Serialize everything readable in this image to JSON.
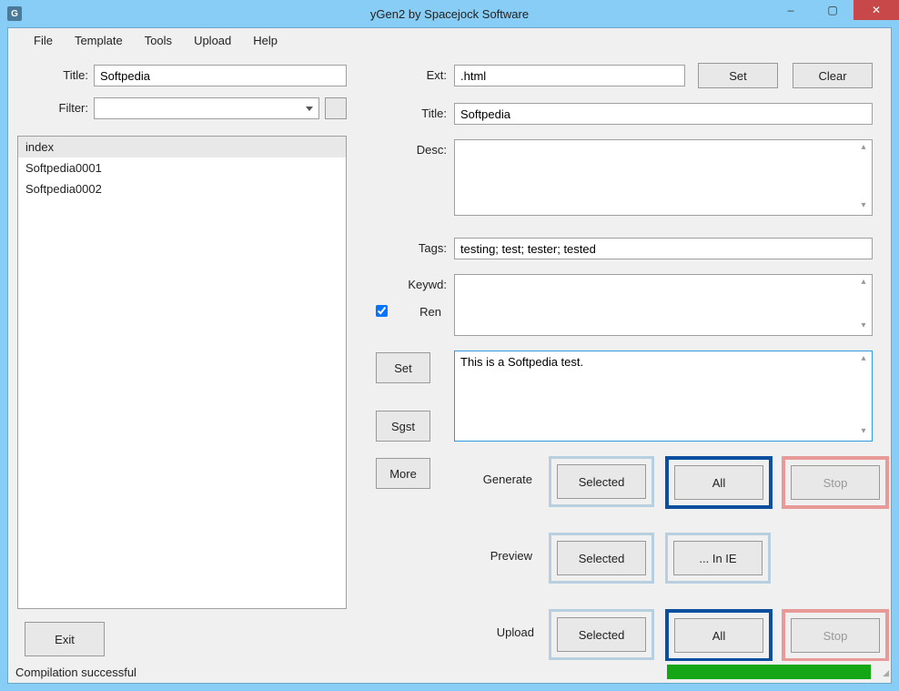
{
  "window": {
    "title": "yGen2 by Spacejock Software",
    "icon_letter": "G",
    "minimize": "–",
    "maximize": "▢",
    "close": "✕"
  },
  "menu": {
    "file": "File",
    "template": "Template",
    "tools": "Tools",
    "upload": "Upload",
    "help": "Help"
  },
  "left": {
    "title_label": "Title:",
    "title_value": "Softpedia",
    "filter_label": "Filter:",
    "filter_value": "",
    "list": [
      "index",
      "Softpedia0001",
      "Softpedia0002"
    ],
    "exit": "Exit"
  },
  "right": {
    "ext_label": "Ext:",
    "ext_value": ".html",
    "set1": "Set",
    "clear": "Clear",
    "title_label": "Title:",
    "title_value": "Softpedia",
    "desc_label": "Desc:",
    "desc_value": "",
    "tags_label": "Tags:",
    "tags_value": "testing; test; tester; tested",
    "keywd_label": "Keywd:",
    "keywd_value": "",
    "ren_label": "Ren",
    "ren_checked": true,
    "set2": "Set",
    "body_value": "This is a Softpedia test.",
    "sgst": "Sgst",
    "more": "More",
    "generate_label": "Generate",
    "preview_label": "Preview",
    "upload_label": "Upload",
    "selected": "Selected",
    "all": "All",
    "stop": "Stop",
    "inie": "... In IE"
  },
  "status": {
    "message": "Compilation successful"
  }
}
